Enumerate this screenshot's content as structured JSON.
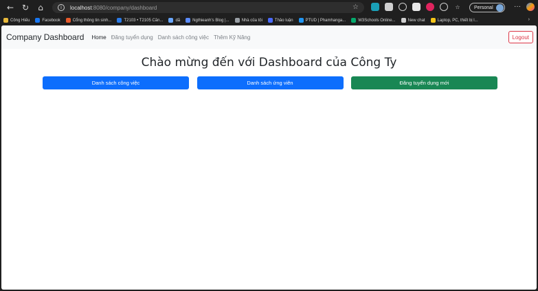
{
  "browser": {
    "url_host": "localhost",
    "url_rest": ":8080/company/dashboard",
    "profile_label": "Personal",
    "bookmarks": [
      {
        "label": "Công Hiếu",
        "color": "#e8b93b"
      },
      {
        "label": "Facebook",
        "color": "#1877f2"
      },
      {
        "label": "Cổng thông tin sinh...",
        "color": "#e85a2b"
      },
      {
        "label": "T2103 • T2105 Căn...",
        "color": "#2b7be8"
      },
      {
        "label": "dã",
        "color": "#6aa7ff"
      },
      {
        "label": "Ngthieanh's Blog |...",
        "color": "#5b8cff"
      },
      {
        "label": "Nhà của tôi",
        "color": "#9aa0a6"
      },
      {
        "label": "Thảo luận",
        "color": "#4b6bff"
      },
      {
        "label": "PTUD | Phamhanga...",
        "color": "#2196f3"
      },
      {
        "label": "W3Schools Online...",
        "color": "#04aa6d"
      },
      {
        "label": "New chat",
        "color": "#cfcfcf"
      },
      {
        "label": "Laptop, PC, thiết bị l...",
        "color": "#f5c518"
      }
    ]
  },
  "navbar": {
    "brand": "Company Dashboard",
    "links": [
      "Home",
      "Đăng tuyển dụng",
      "Danh sách công việc",
      "Thêm Kỹ Năng"
    ],
    "logout": "Logout"
  },
  "main": {
    "title": "Chào mừng đến với Dashboard của Công Ty",
    "buttons": [
      "Danh sách công việc",
      "Danh sách ứng viên",
      "Đăng tuyển dụng mới"
    ]
  },
  "colors": {
    "primary": "#0d6efd",
    "success": "#198754",
    "danger": "#dc3545"
  }
}
